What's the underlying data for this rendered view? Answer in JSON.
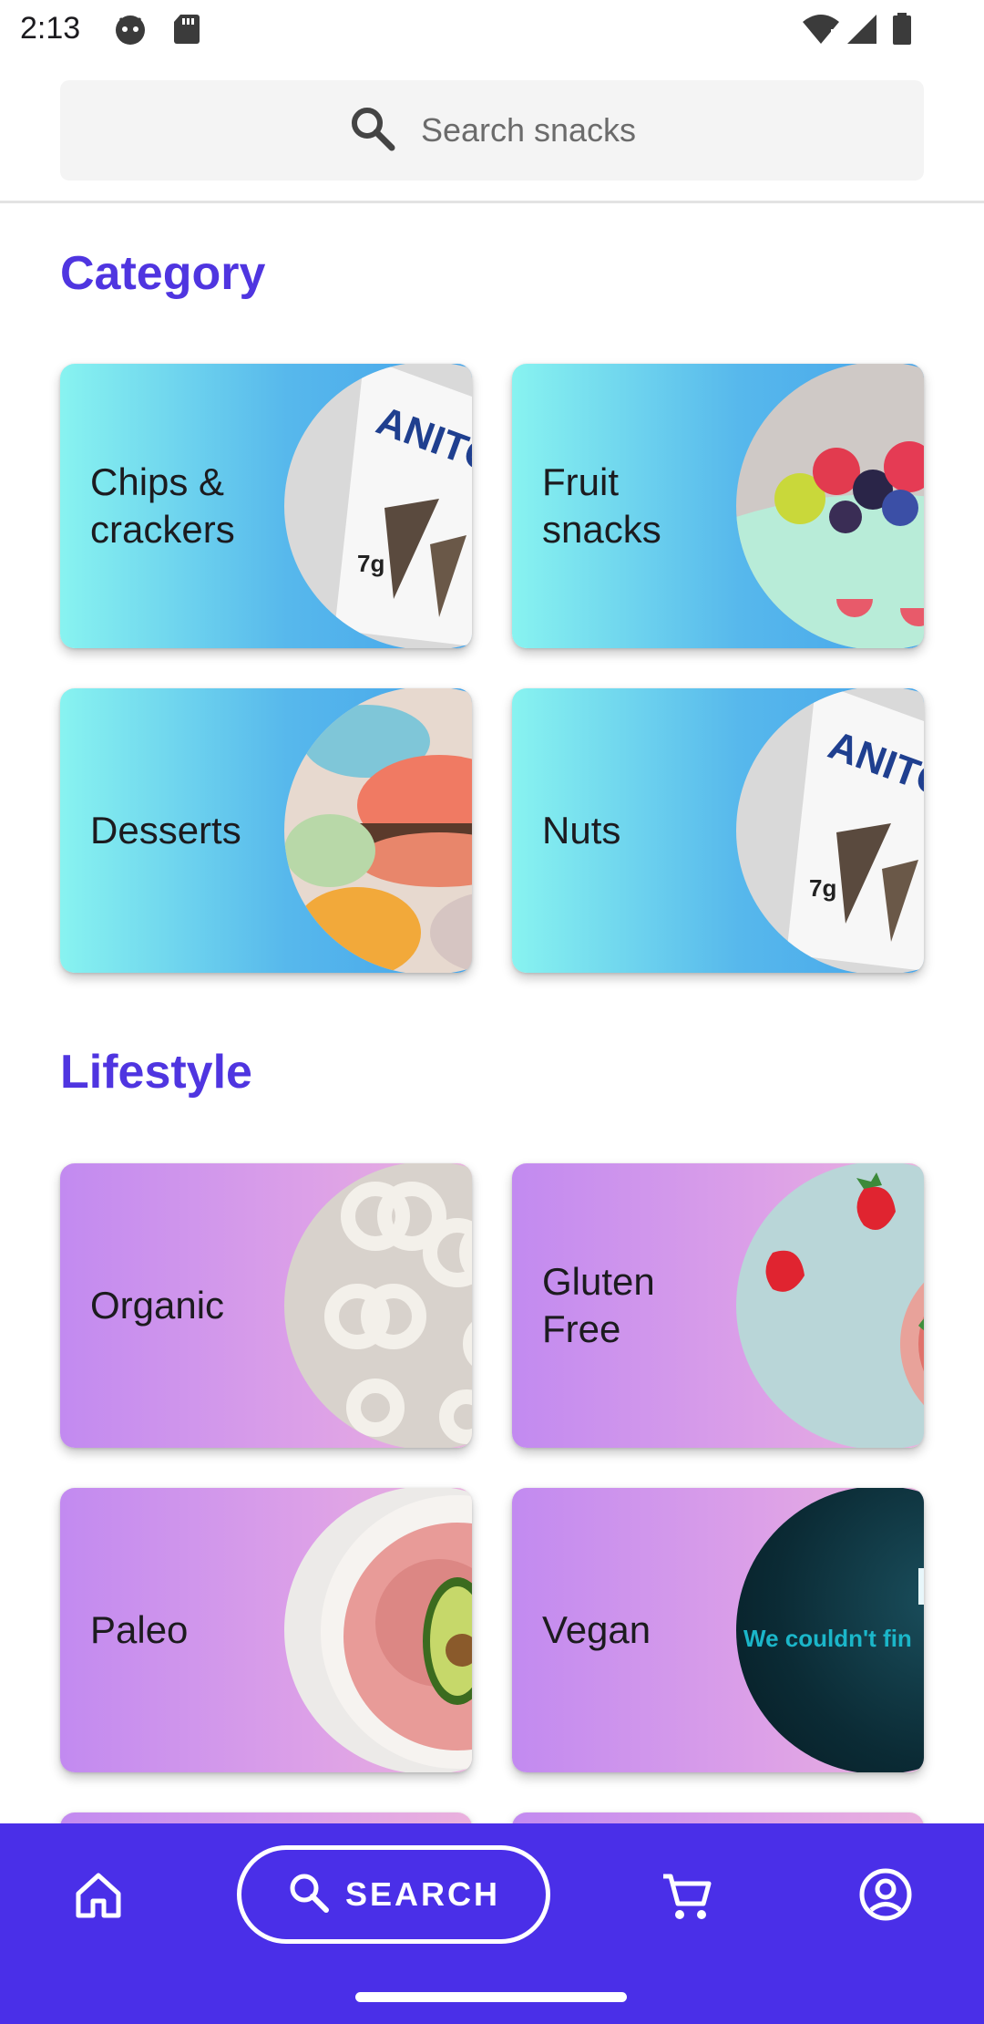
{
  "status_bar": {
    "time": "2:13",
    "left_icons": [
      "android-icon",
      "sd-card-icon"
    ],
    "right_icons": [
      "wifi-icon",
      "signal-icon",
      "battery-icon"
    ]
  },
  "search": {
    "placeholder": "Search snacks",
    "icon": "search-icon"
  },
  "sections": {
    "category": {
      "title": "Category",
      "cards": [
        {
          "label": "Chips &\ncrackers",
          "image": "chips-bag"
        },
        {
          "label": "Fruit\nsnacks",
          "image": "fruit-bowl"
        },
        {
          "label": "Desserts",
          "image": "macarons"
        },
        {
          "label": "Nuts",
          "image": "chips-bag"
        }
      ]
    },
    "lifestyle": {
      "title": "Lifestyle",
      "cards": [
        {
          "label": "Organic",
          "image": "pretzels"
        },
        {
          "label": "Gluten\nFree",
          "image": "strawberry-drink"
        },
        {
          "label": "Paleo",
          "image": "avocado-smoothie"
        },
        {
          "label": "Vegan",
          "image": "not-found",
          "image_text": "We couldn't fin"
        }
      ]
    }
  },
  "bottom_nav": {
    "items": [
      "home-icon",
      "search-button",
      "cart-icon",
      "account-icon"
    ],
    "search_label": "SEARCH"
  },
  "colors": {
    "accent": "#4F35E0",
    "nav_bg": "#4A2FE8",
    "category_gradient": [
      "#88F3F0",
      "#45A4EA"
    ],
    "lifestyle_gradient": [
      "#C28AF0",
      "#EAB1DD"
    ]
  }
}
